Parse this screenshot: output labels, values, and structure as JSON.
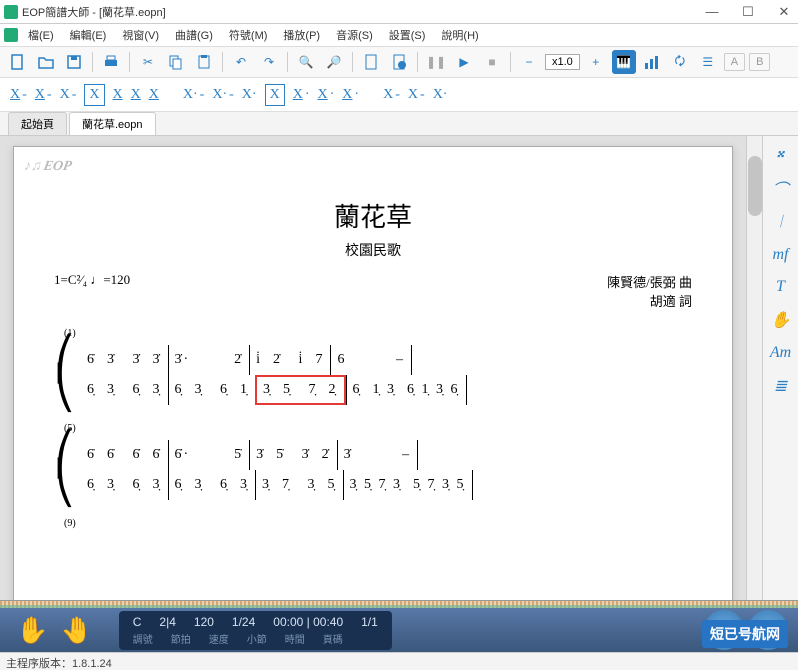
{
  "window": {
    "title": "EOP簡譜大師 - [蘭花草.eopn]",
    "min": "—",
    "max": "☐",
    "close": "✕"
  },
  "menu": {
    "items": [
      "檔(E)",
      "編輯(E)",
      "視窗(V)",
      "曲譜(G)",
      "符號(M)",
      "播放(P)",
      "音源(S)",
      "設置(S)",
      "說明(H)"
    ]
  },
  "toolbar": {
    "speed": "x1.0",
    "ab_a": "A",
    "ab_b": "B"
  },
  "tabs": {
    "start": "起始頁",
    "file": "蘭花草.eopn"
  },
  "side": {
    "items": [
      "𝄪",
      "⌒",
      "𝄀",
      "mf",
      "T",
      "✋",
      "Am",
      "≣"
    ]
  },
  "sheet": {
    "logo": "EOP",
    "title": "蘭花草",
    "subtitle": "校園民歌",
    "key_tempo": "1=C²⁄₄  ♩=120",
    "composer": "陳賢德/張弼 曲",
    "lyricist": "胡適 詞",
    "m1": "(1)",
    "m5": "(5)",
    "m9": "(9)",
    "row1_t": [
      "6̇  3̇   3̇  3̇",
      "3̇·        2̇",
      "i̇  2̇   i̇  7",
      "6         –"
    ],
    "row1_b": [
      "6̣  3̣   6̣  3̣",
      "6̣  3̣   6̣  1̣",
      "3̣  5̣   7̣  2̣",
      "6̣  1̣ 3̣  6̣ 1̣ 3̣ 6̣"
    ],
    "row2_t": [
      "6̇  6̇   6̇  6̇",
      "6̇·        5̇",
      "3̇  5̇   3̇  2̇",
      "3̇         –"
    ],
    "row2_b": [
      "6̣  3̣   6̣  3̣",
      "6̣  3̣   6̣  3̣",
      "3̣  7̣   3̣  5̣",
      "3̣ 5̣ 7̣ 3̣  5̣ 7̣ 3̣ 5̣"
    ]
  },
  "player": {
    "labels": [
      "調號",
      "節拍",
      "速度",
      "小節",
      "時間",
      "頁碼"
    ],
    "values": [
      "C",
      "2|4",
      "120",
      "1/24",
      "00:00 | 00:40",
      "1/1"
    ]
  },
  "status": {
    "version_label": "主程序版本：",
    "version": "1.8.1.24"
  },
  "overlay": "短已号航网"
}
